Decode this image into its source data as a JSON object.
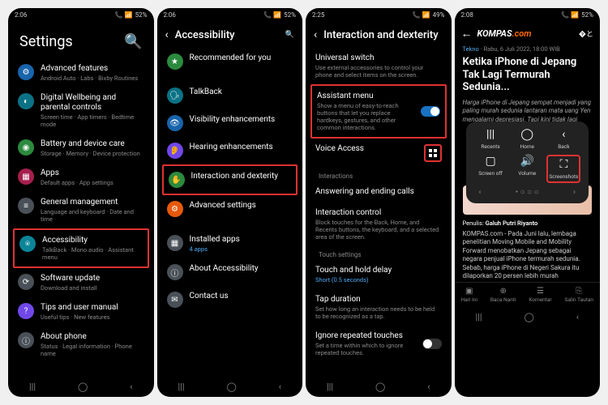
{
  "status": {
    "time1": "2:06",
    "time2": "2:06",
    "time3": "2:25",
    "time4": "2:08",
    "batt1": "52%",
    "batt2": "52%",
    "batt3": "49%",
    "batt4": "52%",
    "signal": "📶"
  },
  "s1": {
    "title": "Settings",
    "items": [
      {
        "title": "Advanced features",
        "sub": "Android Auto · Labs · Bixby Routines"
      },
      {
        "title": "Digital Wellbeing and parental controls",
        "sub": "Screen time · App timers · Bedtime mode"
      },
      {
        "title": "Battery and device care",
        "sub": "Storage · Memory · Device protection"
      },
      {
        "title": "Apps",
        "sub": "Default apps · App settings"
      },
      {
        "title": "General management",
        "sub": "Language and keyboard · Date and time"
      },
      {
        "title": "Accessibility",
        "sub": "TalkBack · Mono audio · Assistant menu"
      },
      {
        "title": "Software update",
        "sub": "Download and install"
      },
      {
        "title": "Tips and user manual",
        "sub": "Useful tips · New features"
      },
      {
        "title": "About phone",
        "sub": "Status · Legal information · Phone name"
      }
    ]
  },
  "s2": {
    "title": "Accessibility",
    "items": [
      {
        "title": "Recommended for you",
        "sub": ""
      },
      {
        "title": "TalkBack",
        "sub": ""
      },
      {
        "title": "Visibility enhancements",
        "sub": ""
      },
      {
        "title": "Hearing enhancements",
        "sub": ""
      },
      {
        "title": "Interaction and dexterity",
        "sub": ""
      },
      {
        "title": "Advanced settings",
        "sub": ""
      },
      {
        "title": "Installed apps",
        "sub": "4 apps"
      },
      {
        "title": "About Accessibility",
        "sub": ""
      },
      {
        "title": "Contact us",
        "sub": ""
      }
    ]
  },
  "s3": {
    "title": "Interaction and dexterity",
    "items": {
      "universal": {
        "title": "Universal switch",
        "sub": "Use external accessories to control your phone and select items on the screen."
      },
      "assistant": {
        "title": "Assistant menu",
        "sub": "Show a menu of easy-to-reach buttons that let you replace hardkeys, gestures, and other common interactions."
      },
      "voice": {
        "title": "Voice Access"
      },
      "sec_interactions": "Interactions",
      "answering": {
        "title": "Answering and ending calls"
      },
      "control": {
        "title": "Interaction control",
        "sub": "Block touches for the Back, Home, and Recents buttons, the keyboard, and a selected area of the screen."
      },
      "sec_touch": "Touch settings",
      "hold": {
        "title": "Touch and hold delay",
        "sub": "Short (0.5 seconds)"
      },
      "tap": {
        "title": "Tap duration",
        "sub": "Set how long an interaction needs to be held to be recognized as a tap."
      },
      "ignore": {
        "title": "Ignore repeated touches",
        "sub": "Set a time within which to ignore repeated touches."
      }
    }
  },
  "s4": {
    "logo1": "KOMPAS",
    "logo2": ".com",
    "category": "Tekno",
    "date": "Rabu, 6 Juli 2022, 18:00 WIB",
    "title": "Ketika iPhone di Jepang Tak Lagi Termurah Sedunia...",
    "sub": "Harga iPhone di Jepang sempat menjadi yang paling murah sedunia lantaran mata uang Yen mengalami depresiasi. Tapi kini tidak lagi",
    "popup": {
      "r1": [
        {
          "label": "Recents",
          "icon": "|||"
        },
        {
          "label": "Home",
          "icon": "◯"
        },
        {
          "label": "Back",
          "icon": "‹"
        }
      ],
      "r2": [
        {
          "label": "Screen off",
          "icon": "▢"
        },
        {
          "label": "Volume",
          "icon": "🔊"
        },
        {
          "label": "Screenshots",
          "icon": "⛶"
        }
      ]
    },
    "author_label": "Penulis:",
    "author": "Galuh Putri Riyanto",
    "body": "KOMPAS.com - Pada Juni lalu, lembaga penelitian Moving Mobile and Mobility Forward menobatkan Jepang sebagai negara penjual iPhone termurah sedunia. Sebab, harga iPhone di Negeri Sakura itu dilaporkan 20 persen lebih murah",
    "tabs": [
      {
        "label": "Hari Ini",
        "icon": "▣"
      },
      {
        "label": "Baca Nanti",
        "icon": "⊕"
      },
      {
        "label": "Komentar",
        "icon": "☰"
      },
      {
        "label": "Salin Tautan",
        "icon": "⎘"
      }
    ]
  },
  "nav": {
    "recents": "|||",
    "home": "◯",
    "back": "‹"
  }
}
